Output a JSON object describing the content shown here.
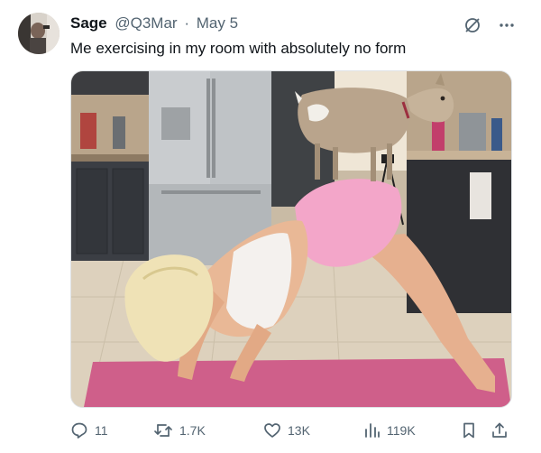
{
  "author": {
    "display_name": "Sage",
    "handle": "@Q3Mar",
    "separator": "·",
    "date": "May 5"
  },
  "tweet": {
    "text": "Me exercising in my room with absolutely no form"
  },
  "header_icons": [
    "grok-icon",
    "more-icon"
  ],
  "media": {
    "alt_description_visible": false
  },
  "actions": {
    "replies": "11",
    "retweets": "1.7K",
    "likes": "13K",
    "views": "119K"
  },
  "colors": {
    "text_primary": "#0f1419",
    "text_secondary": "#536471",
    "border": "#dfe3e6"
  }
}
